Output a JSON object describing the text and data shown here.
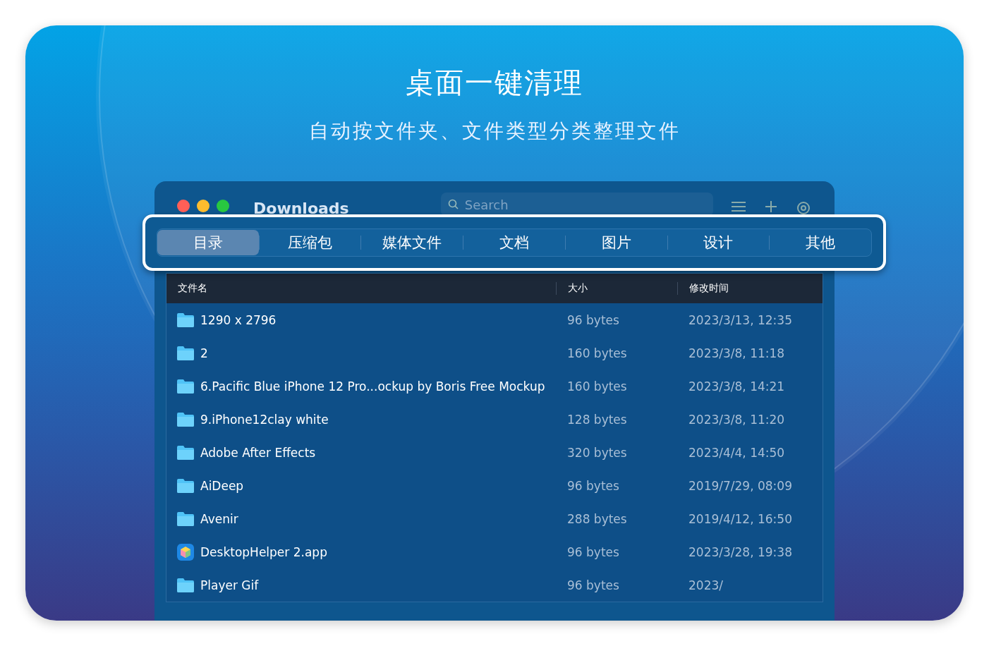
{
  "headline": "桌面一键清理",
  "subheadline": "自动按文件夹、文件类型分类整理文件",
  "window": {
    "title": "Downloads",
    "search": {
      "placeholder": "Search"
    }
  },
  "tabs": [
    {
      "label": "目录",
      "selected": true
    },
    {
      "label": "压缩包",
      "selected": false
    },
    {
      "label": "媒体文件",
      "selected": false
    },
    {
      "label": "文档",
      "selected": false
    },
    {
      "label": "图片",
      "selected": false
    },
    {
      "label": "设计",
      "selected": false
    },
    {
      "label": "其他",
      "selected": false
    }
  ],
  "table": {
    "columns": [
      "文件名",
      "大小",
      "修改时间"
    ],
    "rows": [
      {
        "kind": "folder",
        "name": "1290 x 2796",
        "size": "96 bytes",
        "modified": "2023/3/13, 12:35"
      },
      {
        "kind": "folder",
        "name": "2",
        "size": "160 bytes",
        "modified": "2023/3/8, 11:18"
      },
      {
        "kind": "folder",
        "name": "6.Pacific Blue iPhone 12 Pro...ockup by Boris Free Mockup",
        "size": "160 bytes",
        "modified": "2023/3/8, 14:21"
      },
      {
        "kind": "folder",
        "name": "9.iPhone12clay white",
        "size": "128 bytes",
        "modified": "2023/3/8, 11:20"
      },
      {
        "kind": "folder",
        "name": "Adobe After Effects",
        "size": "320 bytes",
        "modified": "2023/4/4, 14:50"
      },
      {
        "kind": "folder",
        "name": "AiDeep",
        "size": "96 bytes",
        "modified": "2019/7/29, 08:09"
      },
      {
        "kind": "folder",
        "name": "Avenir",
        "size": "288 bytes",
        "modified": "2019/4/12, 16:50"
      },
      {
        "kind": "app",
        "name": "DesktopHelper 2.app",
        "size": "96 bytes",
        "modified": "2023/3/28, 19:38"
      },
      {
        "kind": "folder",
        "name": "Player Gif",
        "size": "96 bytes",
        "modified": "2023/"
      }
    ]
  }
}
